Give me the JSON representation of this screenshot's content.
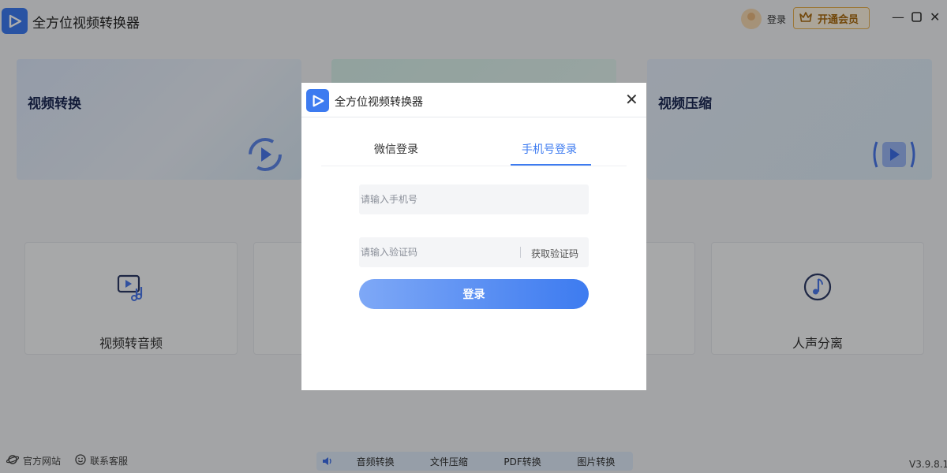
{
  "app": {
    "title": "全方位视频转换器",
    "login_label": "登录",
    "vip_label": "开通会员",
    "version": "V3.9.8.1"
  },
  "cards": {
    "big": [
      "视频转换",
      "",
      "视频压缩"
    ],
    "small": [
      "视频转音频",
      "",
      "",
      "人声分离"
    ]
  },
  "footer": {
    "website": "官方网站",
    "support": "联系客服"
  },
  "bottom_bar": [
    "音频转换",
    "文件压缩",
    "PDF转换",
    "图片转换"
  ],
  "dialog": {
    "title": "全方位视频转换器",
    "tabs": [
      "微信登录",
      "手机号登录"
    ],
    "active_tab": "手机号登录",
    "phone_placeholder": "请输入手机号",
    "code_placeholder": "请输入验证码",
    "get_code_label": "获取验证码",
    "submit_label": "登录"
  },
  "colors": {
    "accent": "#3d7bf0",
    "vip_border": "#e6b155",
    "vip_text": "#a86a10"
  }
}
